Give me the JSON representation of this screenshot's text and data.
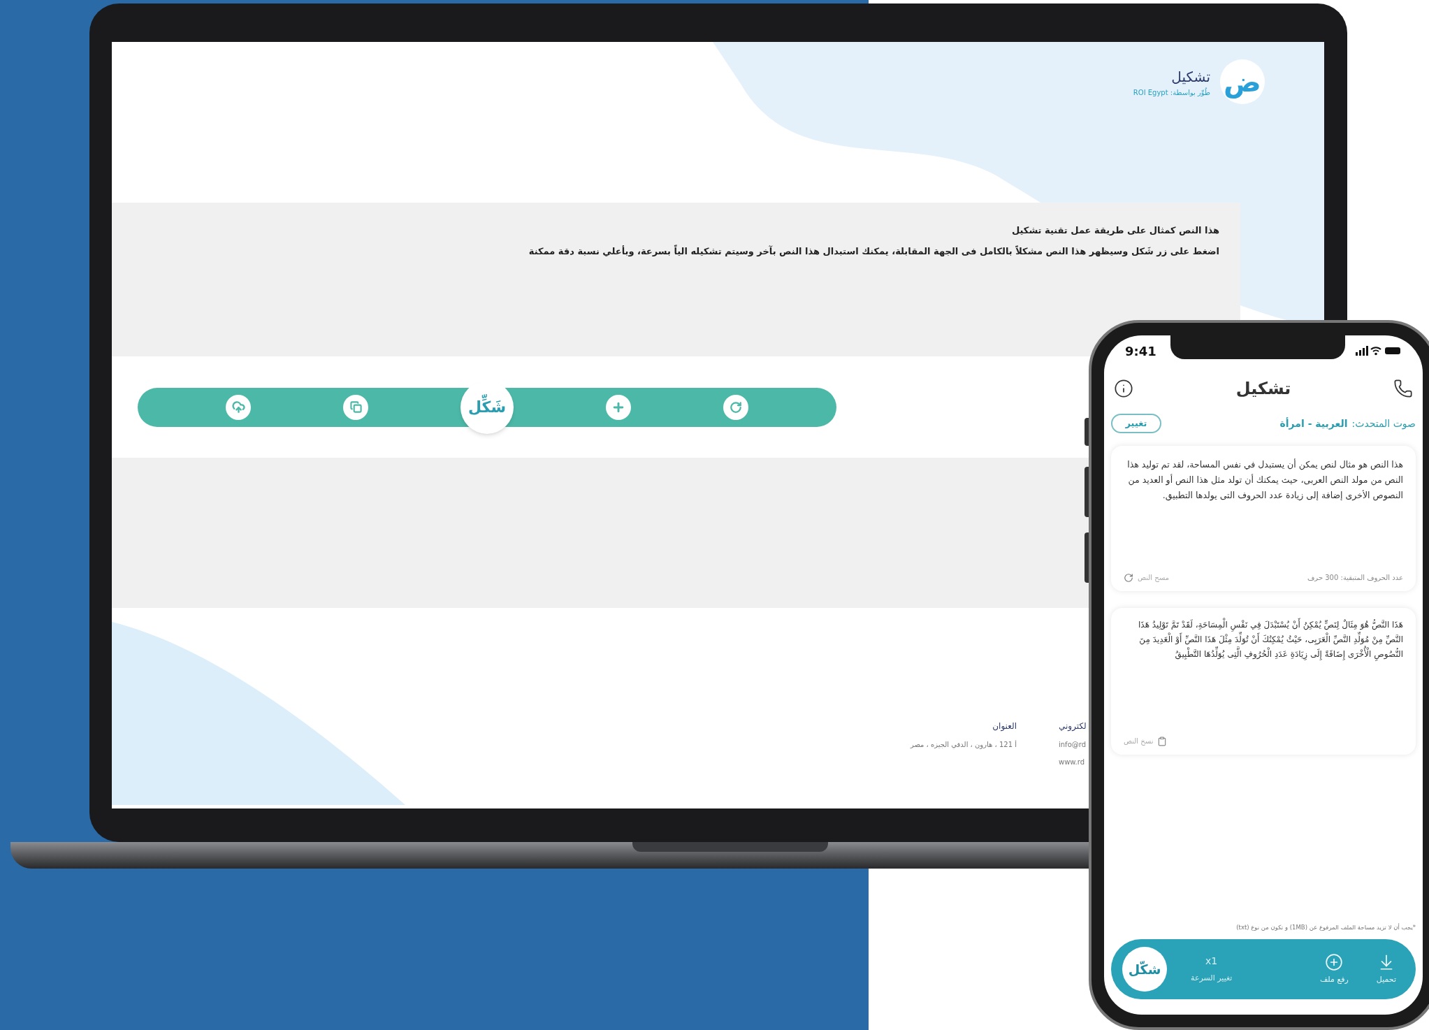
{
  "laptop": {
    "logo": {
      "glyph": "ض",
      "title": "تشكيل",
      "subtitle": "طُوِّر بواسطة: ROI Egypt"
    },
    "intro": {
      "lines": [
        "هذا النص كمثال على طريقة عمل تقنية تشكيل",
        "اضغط على زر شَكل وسيظهر هذا النص مشكلاً بالكامل فى الجهة المقابلة، يمكنك استبدال هذا النص بآخر وسيتم تشكيله الياً بسرعة، وبأعلي نسبة دقة ممكنة"
      ]
    },
    "toolbar": [
      {
        "kind": "reset"
      },
      {
        "kind": "add"
      },
      {
        "kind": "shakkil",
        "label": "شَكِّل"
      },
      {
        "kind": "copy"
      },
      {
        "kind": "upload"
      }
    ],
    "footer": [
      {
        "heading": "لكتروني",
        "lines": [
          "info@rd",
          "www.rd"
        ]
      },
      {
        "heading": "العنوان",
        "lines": [
          "أ 121 ، هارون ، الدقي الجيزه ، مصر"
        ]
      }
    ]
  },
  "phone": {
    "status_bar": {
      "time": "9:41"
    },
    "title": "تشكيل",
    "voice": {
      "label": "صوت المتحدث:",
      "value": "العربية - امرأة",
      "button": "تغيير"
    },
    "input_card": {
      "text": "هذا النص هو مثال لنص يمكن أن يستبدل في نفس المساحة، لقد تم توليد هذا النص من مولد النص العربى، حيث يمكنك أن تولد مثل هذا النص أو العديد من النصوص الأخرى إضافة إلى زيادة عدد الحروف التى يولدها التطبيق.",
      "counter": "عدد الحروف المتبقية: 300 حرف",
      "action": "مسح النص"
    },
    "output_card": {
      "text": "هَذَا النَّصُّ هُوَ مِثَالٌ لِنَصٍّ يُمْكِنُ أَنْ يُسْتَبْدَلَ فِي نَفْسِ الْمِسَاحَةِ، لَقَدْ تَمَّ تَوْلِيدُ هَذَا النَّصِّ مِنْ مُوَلِّدِ النَّصِّ الْعَرَبِى، حَيْثُ يُمْكِنُكَ أَنْ تُوَلِّدَ مِثْلَ هَذَا النَّصِّ أَوْ الْعَدِيدَ مِنَ النُّصُوصِ الْأُخْرَى إِضَافَةً إِلَى زِيَادَةِ عَدَدِ الْحُرُوفِ الَّتِى يُوَلِّدُهَا التَّطْبِيقُ",
      "action": "نسخ النص"
    },
    "note": "*يجب أن لا تزيد مساحة الملف المرفوع عن (1MB) و تكون من نوع (txt)",
    "bottom_bar": [
      {
        "kind": "download",
        "label": "تحميل"
      },
      {
        "kind": "upload",
        "label": "رفع ملف"
      },
      {
        "kind": "speed",
        "value": "x1",
        "label": "تغيير السرعة"
      },
      {
        "kind": "shakkil",
        "label": "شكّل"
      }
    ]
  }
}
